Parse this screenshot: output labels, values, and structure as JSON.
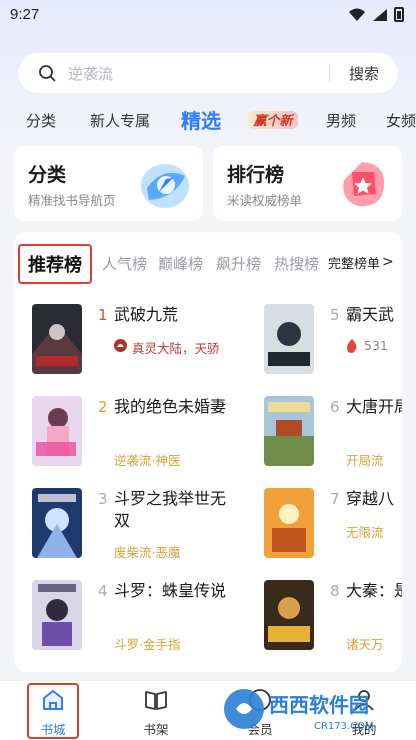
{
  "status_bar": {
    "time": "9:27"
  },
  "search": {
    "placeholder": "逆袭流",
    "button": "搜索"
  },
  "tabs": [
    {
      "label": "分类"
    },
    {
      "label": "新人专属"
    },
    {
      "label": "精选",
      "active": true
    },
    {
      "label": "赢个新"
    },
    {
      "label": "男频"
    },
    {
      "label": "女频"
    }
  ],
  "cards": {
    "category": {
      "title": "分类",
      "subtitle": "精准找书导航页"
    },
    "ranking": {
      "title": "排行榜",
      "subtitle": "米读权威榜单"
    }
  },
  "rank_tabs": [
    {
      "label": "推荐榜",
      "active": true
    },
    {
      "label": "人气榜"
    },
    {
      "label": "巅峰榜"
    },
    {
      "label": "飙升榜"
    },
    {
      "label": "热搜榜"
    }
  ],
  "full_list": {
    "label": "完整榜单",
    "chevron": ">"
  },
  "books": [
    {
      "rank": "1",
      "title": "武破九荒",
      "tag": "真灵大陆，天骄"
    },
    {
      "rank": "2",
      "title": "我的绝色未婚妻",
      "tag": "逆袭流·神医"
    },
    {
      "rank": "3",
      "title": "斗罗之我举世无双",
      "tag": "废柴流·恶魔"
    },
    {
      "rank": "4",
      "title": "斗罗：蛛皇传说",
      "tag": "斗罗·金手指"
    },
    {
      "rank": "5",
      "title": "霸天武",
      "tag": "531"
    },
    {
      "rank": "6",
      "title": "大唐开局李世民",
      "tag": "开局流"
    },
    {
      "rank": "7",
      "title": "穿越八",
      "tag": "无限流"
    },
    {
      "rank": "8",
      "title": "大秦：是秦始皇",
      "tag": "诸天万"
    }
  ],
  "bottom_nav": [
    {
      "label": "书城",
      "active": true
    },
    {
      "label": "书架"
    },
    {
      "label": "会员"
    },
    {
      "label": "我的"
    }
  ],
  "watermark": {
    "text": "西西软件园",
    "sub": "CR173.COM"
  },
  "colors": {
    "accent": "#2f7bff",
    "highlight": "#d6402f",
    "tag": "#d9a23a"
  }
}
